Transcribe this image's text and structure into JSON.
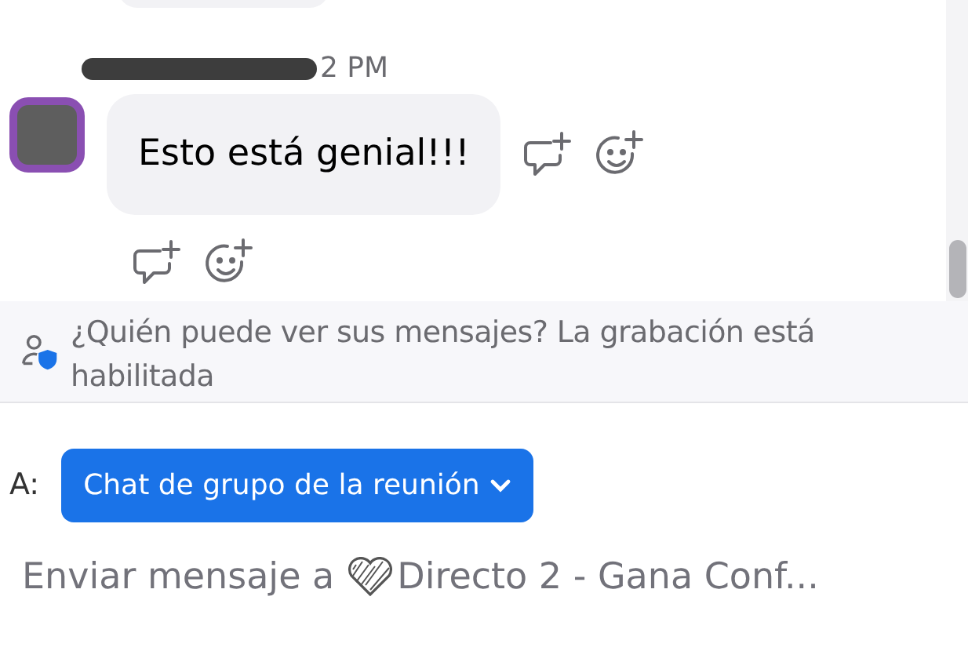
{
  "message": {
    "time": "2 PM",
    "text": "Esto está genial!!!"
  },
  "notice": {
    "text": "¿Quién puede ver sus mensajes? La grabación está habilitada"
  },
  "recipient": {
    "label": "A:",
    "value": "Chat de grupo de la reunión"
  },
  "composer": {
    "placeholder": "Enviar mensaje a",
    "target": "Directo 2 - Gana Conf..."
  }
}
